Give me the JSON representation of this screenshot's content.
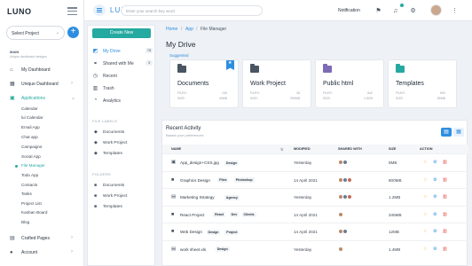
{
  "brand": {
    "name": "LUNO"
  },
  "project_select": {
    "value": "Select Project"
  },
  "sidebar": {
    "section_title": "MAIN",
    "section_subtitle": "Unique dashboard designs",
    "items": [
      {
        "label": "My Dashboard",
        "icon": "home-icon",
        "expandable": false
      },
      {
        "label": "Unique Dashboard",
        "icon": "grid-icon",
        "expandable": true
      },
      {
        "label": "Applications",
        "icon": "apps-icon",
        "expandable": true,
        "active": true
      }
    ],
    "sub_items": [
      "Calendar",
      "lui Calendar",
      "Email App",
      "Chat app",
      "Campaigns",
      "Social App",
      "File Manager",
      "Todo App",
      "Contacts",
      "Tasks",
      "Project List",
      "Kanban Board",
      "Blog"
    ],
    "active_sub": "File Manager",
    "more_items": [
      {
        "label": "Crafted Pages",
        "icon": "pages-icon"
      },
      {
        "label": "Account",
        "icon": "user-icon"
      }
    ]
  },
  "topbar": {
    "logo": "LUNO",
    "search_placeholder": "Enter your search key word",
    "notification": "Notification"
  },
  "breadcrumb": [
    "Home",
    "App",
    "File Manager"
  ],
  "left_panel": {
    "create_label": "Create New",
    "nav": [
      {
        "label": "My Drive",
        "count": "78",
        "icon": "drive-icon",
        "active": true
      },
      {
        "label": "Shared with Me",
        "count": "3",
        "icon": "shared-icon"
      },
      {
        "label": "Recent",
        "count": "",
        "icon": "clock-icon"
      },
      {
        "label": "Trash",
        "count": "",
        "icon": "trash-icon"
      },
      {
        "label": "Analytics",
        "count": "",
        "icon": "chart-icon"
      }
    ],
    "file_labels_title": "FILE LABELS",
    "file_labels": [
      "Documents",
      "Work Project",
      "Templates"
    ],
    "folders_title": "FOLDERS",
    "folders": [
      "Documents",
      "Work Project",
      "Templates"
    ]
  },
  "page_title": "My Drive",
  "suggested_label": "Suggested",
  "cards": [
    {
      "title": "Documents",
      "files_label": "FILES:",
      "files": "245",
      "size_label": "SIZE:",
      "size": "40MB",
      "color": "#4a5563",
      "flagged": true
    },
    {
      "title": "Work Project",
      "files_label": "FILES:",
      "files": "28",
      "size_label": "SIZE:",
      "size": "250MB",
      "color": "#4a5563",
      "flagged": false
    },
    {
      "title": "Public html",
      "files_label": "FILES:",
      "files": "842",
      "size_label": "SIZE:",
      "size": "1.5GB",
      "color": "#7e6bb5",
      "flagged": false
    },
    {
      "title": "Templates",
      "files_label": "FILES:",
      "files": "899",
      "size_label": "SIZE:",
      "size": "80MB",
      "color": "#25a9a0",
      "flagged": false
    }
  ],
  "recent": {
    "title": "Recent Activity",
    "subtitle": "Based your preferences",
    "columns": {
      "name": "NAME",
      "modified": "MODIFIED",
      "shared": "SHARED WITH",
      "size": "SIZE",
      "action": "ACTION"
    },
    "rows": [
      {
        "name": "App_design+CSS.jpg",
        "icon": "image-icon",
        "tags": [
          "Design"
        ],
        "modified": "Yesterday",
        "shared": 2,
        "size": "5MB"
      },
      {
        "name": "Graphics Design",
        "icon": "folder-icon",
        "tags": [
          "Files",
          "Photoshop"
        ],
        "modified": "14 April 2021",
        "shared": 3,
        "size": "800MB"
      },
      {
        "name": "Marketing Strategy",
        "icon": "file-icon",
        "tags": [
          "Agency"
        ],
        "modified": "Yesterday",
        "shared": 3,
        "size": "1.2MB"
      },
      {
        "name": "React Project",
        "icon": "folder-icon",
        "tags": [
          "React",
          "Dev",
          "Clients"
        ],
        "modified": "14 April 2021",
        "shared": 1,
        "size": "345MB"
      },
      {
        "name": "Web Design",
        "icon": "folder-icon",
        "tags": [
          "Design",
          "Project"
        ],
        "modified": "14 April 2021",
        "shared": 2,
        "size": "12MB"
      },
      {
        "name": "work sheet.xls",
        "icon": "file-icon",
        "tags": [
          "Design"
        ],
        "modified": "Yesterday",
        "shared": 1,
        "size": "1.4MB"
      }
    ]
  },
  "colors": {
    "accent": "#25a9a0",
    "primary": "#2d8ee0",
    "star": "#f2b51b",
    "gear": "#2d8ee0",
    "delete": "#e0463c"
  }
}
